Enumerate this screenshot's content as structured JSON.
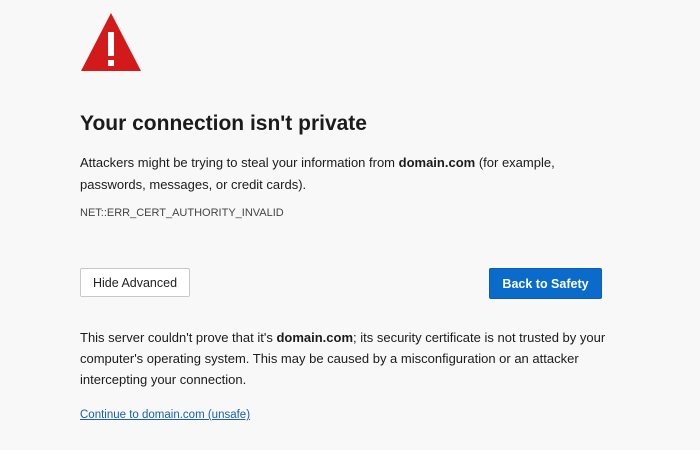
{
  "warning": {
    "icon": "warning-triangle-icon",
    "icon_color": "#d31a1a",
    "title": "Your connection isn't private",
    "description": {
      "prefix": "Attackers might be trying to steal your information from ",
      "domain": "domain.com",
      "suffix": " (for example, passwords, messages, or credit cards)."
    },
    "error_code": "NET::ERR_CERT_AUTHORITY_INVALID"
  },
  "buttons": {
    "hide_advanced_label": "Hide Advanced",
    "back_to_safety_label": "Back to Safety",
    "primary_color": "#0b6bcb"
  },
  "advanced": {
    "prefix": "This server couldn't prove that it's ",
    "domain": "domain.com",
    "suffix": "; its security certificate is not trusted by your computer's operating system. This may be caused by a misconfiguration or an attacker intercepting your connection.",
    "proceed_link": "Continue to domain.com (unsafe)"
  }
}
